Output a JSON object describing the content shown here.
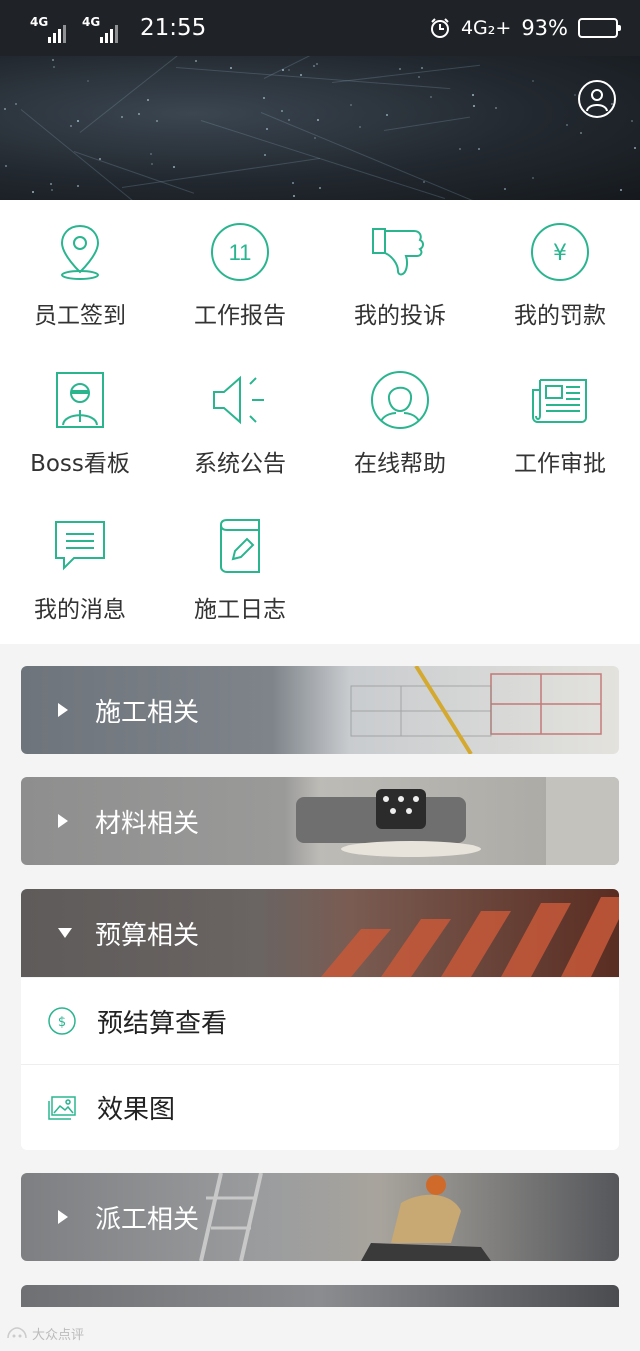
{
  "status_bar": {
    "net1": "4G",
    "net2": "4G",
    "time": "21:55",
    "net3": "4G₂+",
    "battery": "93%",
    "battery_level": 0.93
  },
  "menu": [
    {
      "label": "员工签到",
      "icon": "location-pin-icon"
    },
    {
      "label": "工作报告",
      "icon": "report-11-icon",
      "badge": "11"
    },
    {
      "label": "我的投诉",
      "icon": "thumbs-down-icon"
    },
    {
      "label": "我的罚款",
      "icon": "yen-icon",
      "glyph": "¥"
    },
    {
      "label": "Boss看板",
      "icon": "boss-board-icon"
    },
    {
      "label": "系统公告",
      "icon": "speaker-icon"
    },
    {
      "label": "在线帮助",
      "icon": "help-person-icon"
    },
    {
      "label": "工作审批",
      "icon": "newspaper-icon"
    },
    {
      "label": "我的消息",
      "icon": "message-icon"
    },
    {
      "label": "施工日志",
      "icon": "log-book-icon"
    }
  ],
  "sections": [
    {
      "label": "施工相关",
      "expanded": false
    },
    {
      "label": "材料相关",
      "expanded": false
    },
    {
      "label": "预算相关",
      "expanded": true
    },
    {
      "label": "派工相关",
      "expanded": false
    }
  ],
  "budget_items": [
    {
      "label": "预结算查看",
      "icon": "dollar-circle-icon"
    },
    {
      "label": "效果图",
      "icon": "image-gallery-icon"
    }
  ],
  "watermark": "大众点评",
  "colors": {
    "accent": "#2bb58f",
    "status_bg": "#1f2227",
    "menu_text": "#333333"
  }
}
